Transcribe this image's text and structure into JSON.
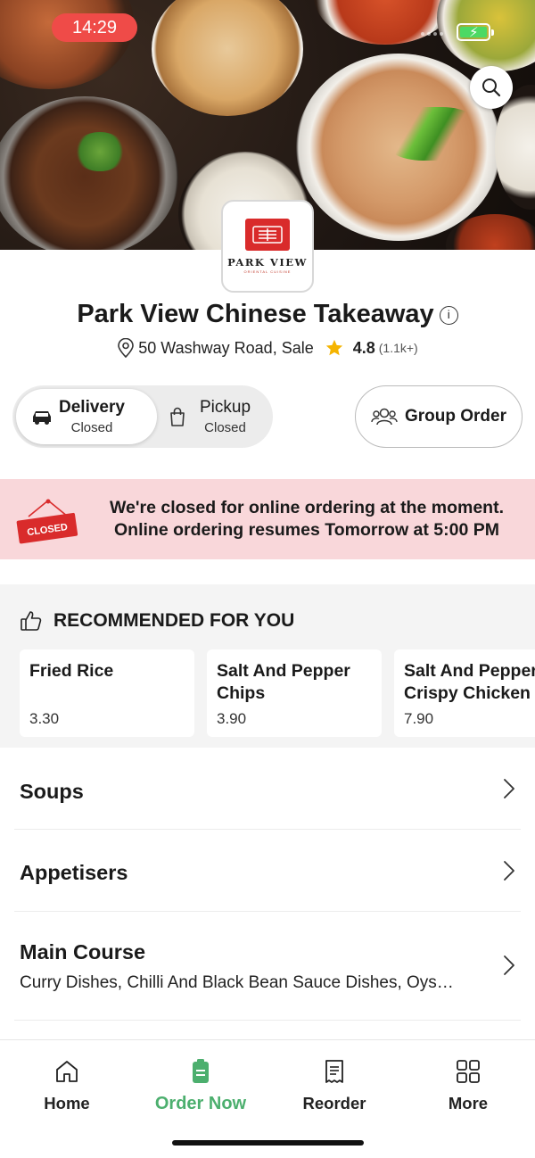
{
  "status_bar": {
    "time": "14:29"
  },
  "restaurant": {
    "logo_text": "PARK VIEW",
    "logo_sub": "ORIENTAL CUISINE",
    "name": "Park View Chinese Takeaway",
    "address": "50  Washway Road, Sale",
    "rating": "4.8",
    "rating_count": "(1.1k+)"
  },
  "order_mode": {
    "delivery": {
      "label": "Delivery",
      "status": "Closed",
      "selected": true
    },
    "pickup": {
      "label": "Pickup",
      "status": "Closed",
      "selected": false
    },
    "group_order_label": "Group Order"
  },
  "closed_banner": {
    "sign_text": "CLOSED",
    "line1": "We're closed for online ordering at the moment.",
    "line2": "Online ordering resumes Tomorrow at 5:00 PM"
  },
  "recommended": {
    "heading": "RECOMMENDED FOR YOU",
    "items": [
      {
        "name": "Fried Rice",
        "price": "3.30"
      },
      {
        "name": "Salt And Pepper Chips",
        "price": "3.90"
      },
      {
        "name": "Salt And Pepper Crispy Chicken",
        "price": "7.90"
      }
    ]
  },
  "categories": [
    {
      "title": "Soups",
      "description": ""
    },
    {
      "title": "Appetisers",
      "description": ""
    },
    {
      "title": "Main Course",
      "description": "Curry Dishes, Chilli And Black Bean Sauce Dishes, Oys…"
    }
  ],
  "tabbar": {
    "items": [
      {
        "label": "Home",
        "icon": "home-icon",
        "active": false
      },
      {
        "label": "Order Now",
        "icon": "order-icon",
        "active": true
      },
      {
        "label": "Reorder",
        "icon": "receipt-icon",
        "active": false
      },
      {
        "label": "More",
        "icon": "grid-icon",
        "active": false
      }
    ]
  },
  "colors": {
    "accent_green": "#4caf6e",
    "time_pill": "#ef4b48",
    "closed_banner_bg": "#f9d7da",
    "star": "#f5b400",
    "sign_red": "#d92b2b"
  }
}
